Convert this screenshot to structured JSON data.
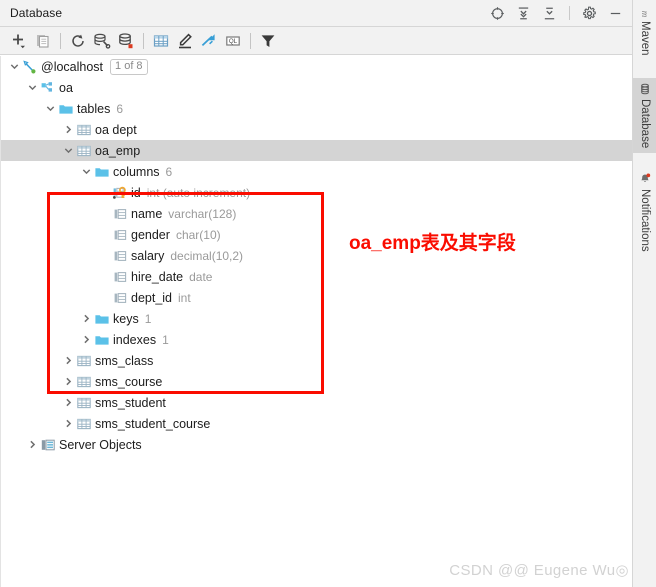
{
  "window": {
    "title": "Database",
    "header_icons": [
      {
        "name": "locate-icon",
        "title": "Scroll from Source"
      },
      {
        "name": "expand-all-icon",
        "title": "Expand All"
      },
      {
        "name": "collapse-all-icon",
        "title": "Collapse All"
      },
      {
        "name": "gear-icon",
        "title": "Settings"
      },
      {
        "name": "minimize-icon",
        "title": "Hide"
      }
    ]
  },
  "toolbar": {
    "items": [
      {
        "name": "add-icon",
        "title": "New"
      },
      {
        "name": "copy-icon",
        "title": "Duplicate"
      },
      {
        "name": "refresh-icon",
        "title": "Refresh"
      },
      {
        "name": "sync-schema-icon",
        "title": "Synchronize"
      },
      {
        "name": "database-error-icon",
        "title": "Data Sources and Drivers"
      },
      {
        "name": "table-grid-icon",
        "title": "Open Data Editor"
      },
      {
        "name": "edit-pencil-icon",
        "title": "Modify Object"
      },
      {
        "name": "jump-to-icon",
        "title": "Jump to Console"
      },
      {
        "name": "query-console-icon",
        "title": "QL Console"
      },
      {
        "name": "filter-funnel-icon",
        "title": "Filter"
      }
    ]
  },
  "tree": {
    "nodes": [
      {
        "indent": 0,
        "arrow": "down",
        "icon": "datasource-icon",
        "label": "@localhost",
        "sub": "",
        "badge": "1 of 8",
        "selected": false
      },
      {
        "indent": 1,
        "arrow": "down",
        "icon": "schema-icon",
        "label": "oa",
        "sub": "",
        "badge": "",
        "selected": false
      },
      {
        "indent": 2,
        "arrow": "down",
        "icon": "folder-icon",
        "label": "tables",
        "sub": "6",
        "badge": "",
        "selected": false
      },
      {
        "indent": 3,
        "arrow": "right",
        "icon": "table-icon",
        "label": "oa dept",
        "sub": "",
        "badge": "",
        "selected": false
      },
      {
        "indent": 3,
        "arrow": "down",
        "icon": "table-icon",
        "label": "oa_emp",
        "sub": "",
        "badge": "",
        "selected": true
      },
      {
        "indent": 4,
        "arrow": "down",
        "icon": "folder-icon",
        "label": "columns",
        "sub": "6",
        "badge": "",
        "selected": false
      },
      {
        "indent": 5,
        "arrow": "none",
        "icon": "primary-key-icon",
        "label": "id",
        "sub": "int (auto increment)",
        "badge": "",
        "selected": false
      },
      {
        "indent": 5,
        "arrow": "none",
        "icon": "column-icon",
        "label": "name",
        "sub": "varchar(128)",
        "badge": "",
        "selected": false
      },
      {
        "indent": 5,
        "arrow": "none",
        "icon": "column-icon",
        "label": "gender",
        "sub": "char(10)",
        "badge": "",
        "selected": false
      },
      {
        "indent": 5,
        "arrow": "none",
        "icon": "column-icon",
        "label": "salary",
        "sub": "decimal(10,2)",
        "badge": "",
        "selected": false
      },
      {
        "indent": 5,
        "arrow": "none",
        "icon": "column-icon",
        "label": "hire_date",
        "sub": "date",
        "badge": "",
        "selected": false
      },
      {
        "indent": 5,
        "arrow": "none",
        "icon": "column-icon",
        "label": "dept_id",
        "sub": "int",
        "badge": "",
        "selected": false
      },
      {
        "indent": 4,
        "arrow": "right",
        "icon": "folder-icon",
        "label": "keys",
        "sub": "1",
        "badge": "",
        "selected": false
      },
      {
        "indent": 4,
        "arrow": "right",
        "icon": "folder-icon",
        "label": "indexes",
        "sub": "1",
        "badge": "",
        "selected": false
      },
      {
        "indent": 3,
        "arrow": "right",
        "icon": "table-icon",
        "label": "sms_class",
        "sub": "",
        "badge": "",
        "selected": false
      },
      {
        "indent": 3,
        "arrow": "right",
        "icon": "table-icon",
        "label": "sms_course",
        "sub": "",
        "badge": "",
        "selected": false
      },
      {
        "indent": 3,
        "arrow": "right",
        "icon": "table-icon",
        "label": "sms_student",
        "sub": "",
        "badge": "",
        "selected": false
      },
      {
        "indent": 3,
        "arrow": "right",
        "icon": "table-icon",
        "label": "sms_student_course",
        "sub": "",
        "badge": "",
        "selected": false
      },
      {
        "indent": 1,
        "arrow": "right",
        "icon": "server-objects-icon",
        "label": "Server Objects",
        "sub": "",
        "badge": "",
        "selected": false
      }
    ]
  },
  "annotation": {
    "note": "oa_emp表及其字段",
    "color": "#fa0c00"
  },
  "watermark": {
    "text": "CSDN @@ Eugene Wu◎"
  },
  "right_bar": {
    "tabs": [
      {
        "name": "maven-tab",
        "label": "Maven",
        "icon": "maven-icon",
        "active": false
      },
      {
        "name": "database-tab",
        "label": "Database",
        "icon": "database-icon",
        "active": true
      },
      {
        "name": "notifications-tab",
        "label": "Notifications",
        "icon": "bell-icon",
        "active": false
      }
    ]
  },
  "colors": {
    "accent_red": "#fa0c00",
    "selection": "#d4d4d4",
    "panel_bg": "#f2f2f2",
    "folder_blue": "#5bc1e8",
    "icon_blue": "#389fd6"
  }
}
